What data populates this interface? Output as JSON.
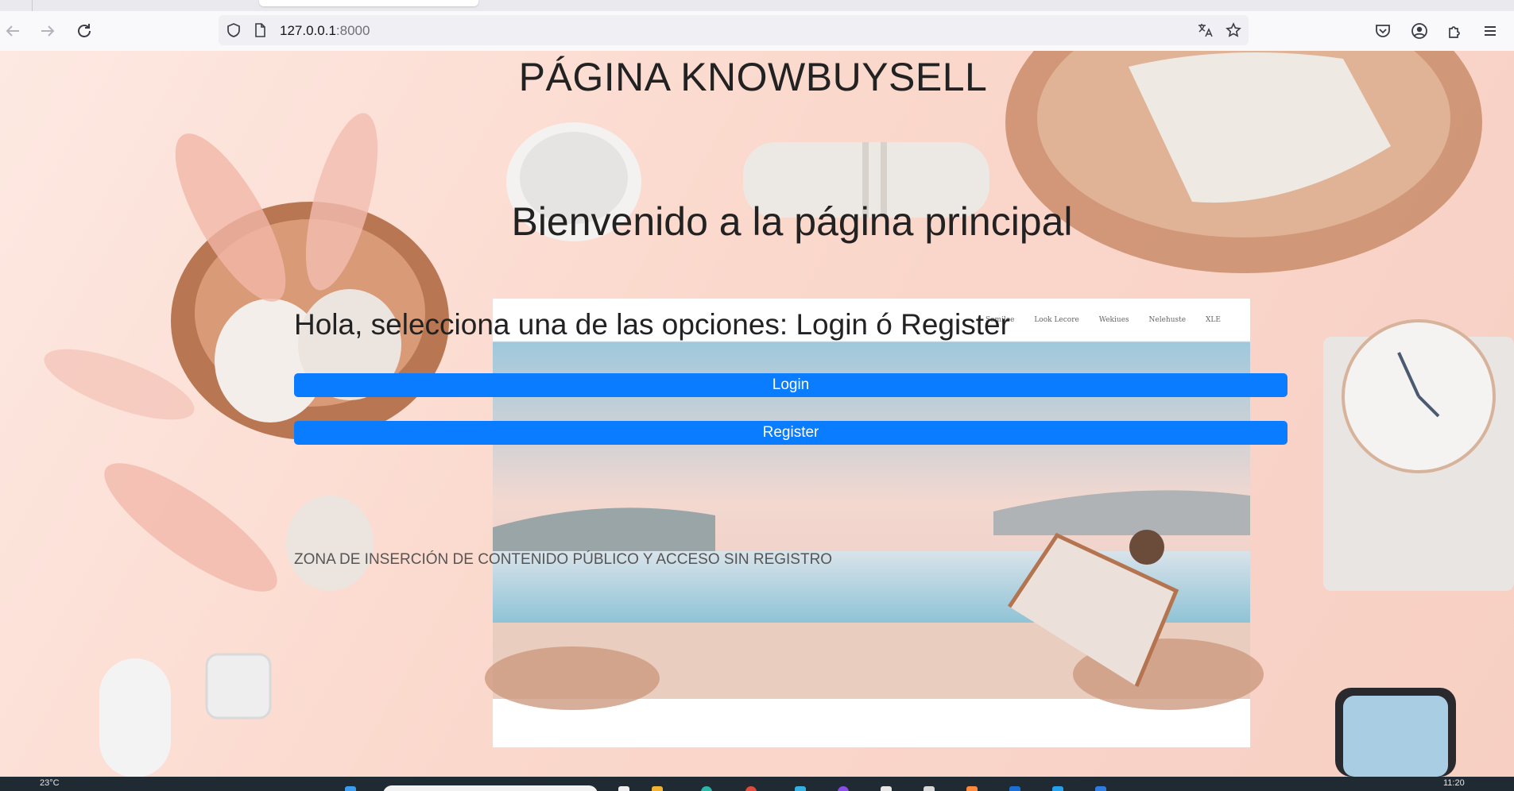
{
  "browser": {
    "url_host": "127.0.0.1",
    "url_port": ":8000"
  },
  "page": {
    "title": "PÁGINA KNOWBUYSELL",
    "welcome": "Bienvenido a la página principal",
    "prompt": "Hola, selecciona una de las opciones: Login ó Register",
    "login_label": "Login",
    "register_label": "Register",
    "public_zone": "ZONA DE INSERCIÓN DE CONTENIDO PÚBLICO Y ACCESO SIN REGISTRO"
  },
  "hero_mockup_nav": [
    "Semilee",
    "Look Lecore",
    "Wekiues",
    "Nelehuste",
    "XLE"
  ],
  "taskbar": {
    "weather": "23°C",
    "clock": "11:20"
  },
  "colors": {
    "button": "#0a7cff",
    "background": "#fbe3da"
  }
}
